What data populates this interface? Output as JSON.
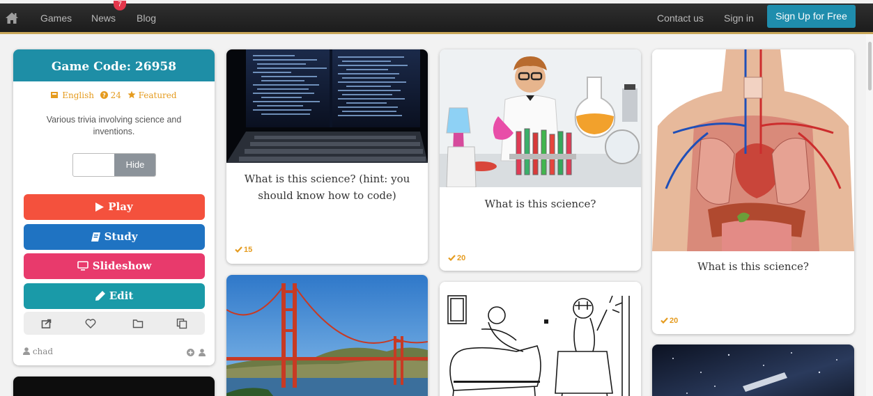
{
  "nav": {
    "links": [
      "Games",
      "News",
      "Blog"
    ],
    "news_badge": "7",
    "contact": "Contact us",
    "signin": "Sign in",
    "signup": "Sign Up for Free"
  },
  "game": {
    "code_title": "Game Code: 26958",
    "language": "English",
    "question_count": "24",
    "featured": "Featured",
    "description": "Various trivia involving science and inventions.",
    "toggle_label": "Hide",
    "buttons": {
      "play": "Play",
      "study": "Study",
      "slideshow": "Slideshow",
      "edit": "Edit"
    },
    "author": "chad"
  },
  "questions": [
    {
      "text": "What is this science? (hint: you should know how to code)",
      "score": "15"
    },
    {
      "text": "What is this science?",
      "score": "20"
    },
    {
      "text": "What is this science?",
      "score": "20"
    }
  ],
  "colors": {
    "accent": "#1e8ea6",
    "play": "#f4513d",
    "study": "#1f73c2",
    "slideshow": "#e83a6c",
    "edit": "#1a9aa8",
    "score": "#e59b1e"
  }
}
